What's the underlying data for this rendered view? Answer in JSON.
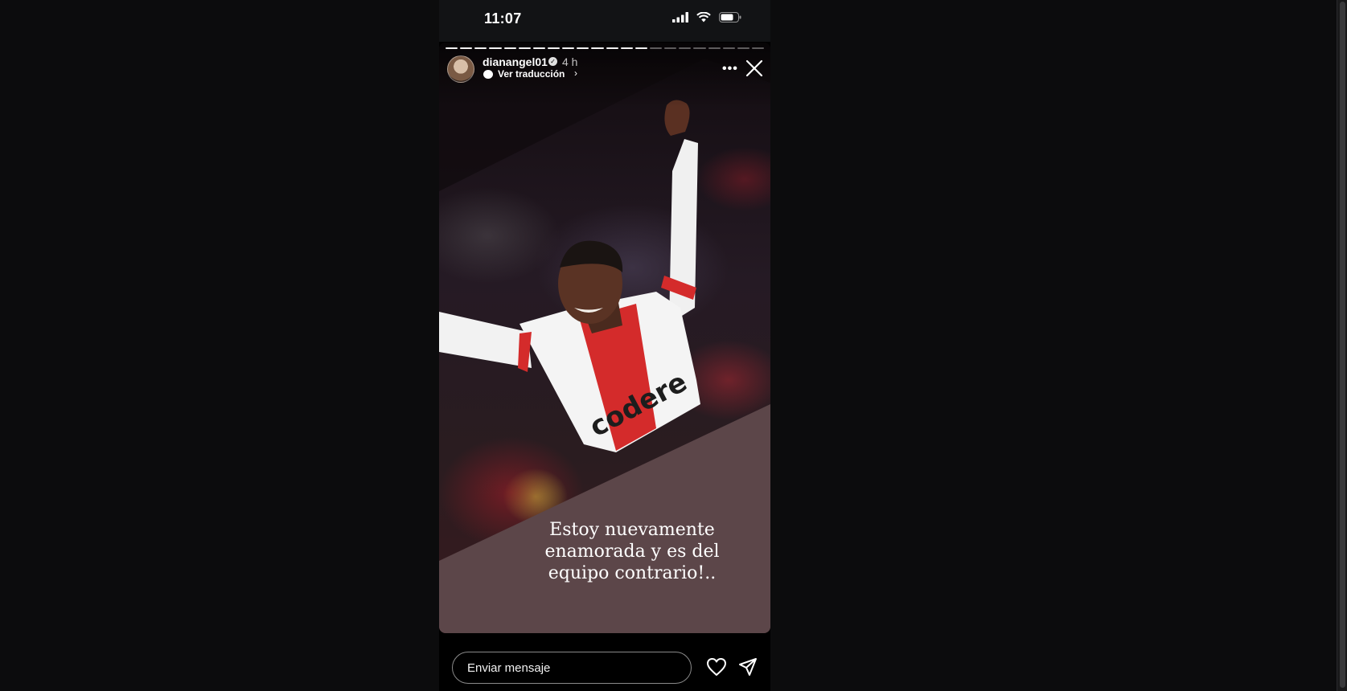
{
  "status_bar": {
    "time": "11:07",
    "icons": [
      "signal-icon",
      "wifi-icon",
      "battery-icon"
    ]
  },
  "story": {
    "segments_total": 22,
    "segments_done": 14,
    "author": {
      "username": "dianangel01",
      "verified": true,
      "time_ago": "4 h"
    },
    "translate_label": "Ver traducción",
    "caption": "Estoy nuevamente enamorada y es del equipo contrario!..",
    "colors": {
      "caption_panel": "#5c4649",
      "jersey_red": "#d42b2b",
      "background": "#0c0c0d"
    }
  },
  "reply": {
    "placeholder": "Enviar mensaje"
  },
  "icons": {
    "more": "more-options-icon",
    "close": "close-icon",
    "like": "heart-icon",
    "send": "send-icon"
  }
}
